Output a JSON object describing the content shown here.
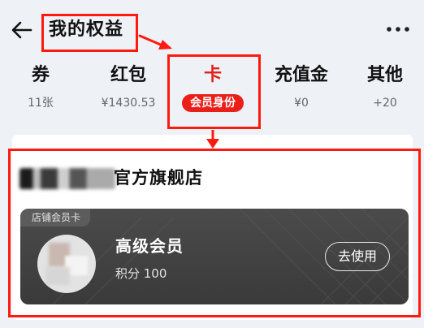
{
  "header": {
    "title": "我的权益",
    "back_icon": "arrow-left-icon",
    "more_icon": "more-dots-icon"
  },
  "tabs": [
    {
      "label": "券",
      "sub": "11张"
    },
    {
      "label": "红包",
      "sub": "¥1430.53"
    },
    {
      "label": "卡",
      "sub": "会员身份",
      "active": true
    },
    {
      "label": "充值金",
      "sub": "¥0"
    },
    {
      "label": "其他",
      "sub": "+20"
    }
  ],
  "store": {
    "name": "官方旗舰店",
    "card": {
      "tag": "店铺会员卡",
      "level": "高级会员",
      "points": "积分 100",
      "use_label": "去使用"
    }
  },
  "colors": {
    "accent": "#e0221a",
    "annotation": "#ff1a0f",
    "card_bg": "#3f3f3f",
    "page_bg": "#eef1f6"
  }
}
